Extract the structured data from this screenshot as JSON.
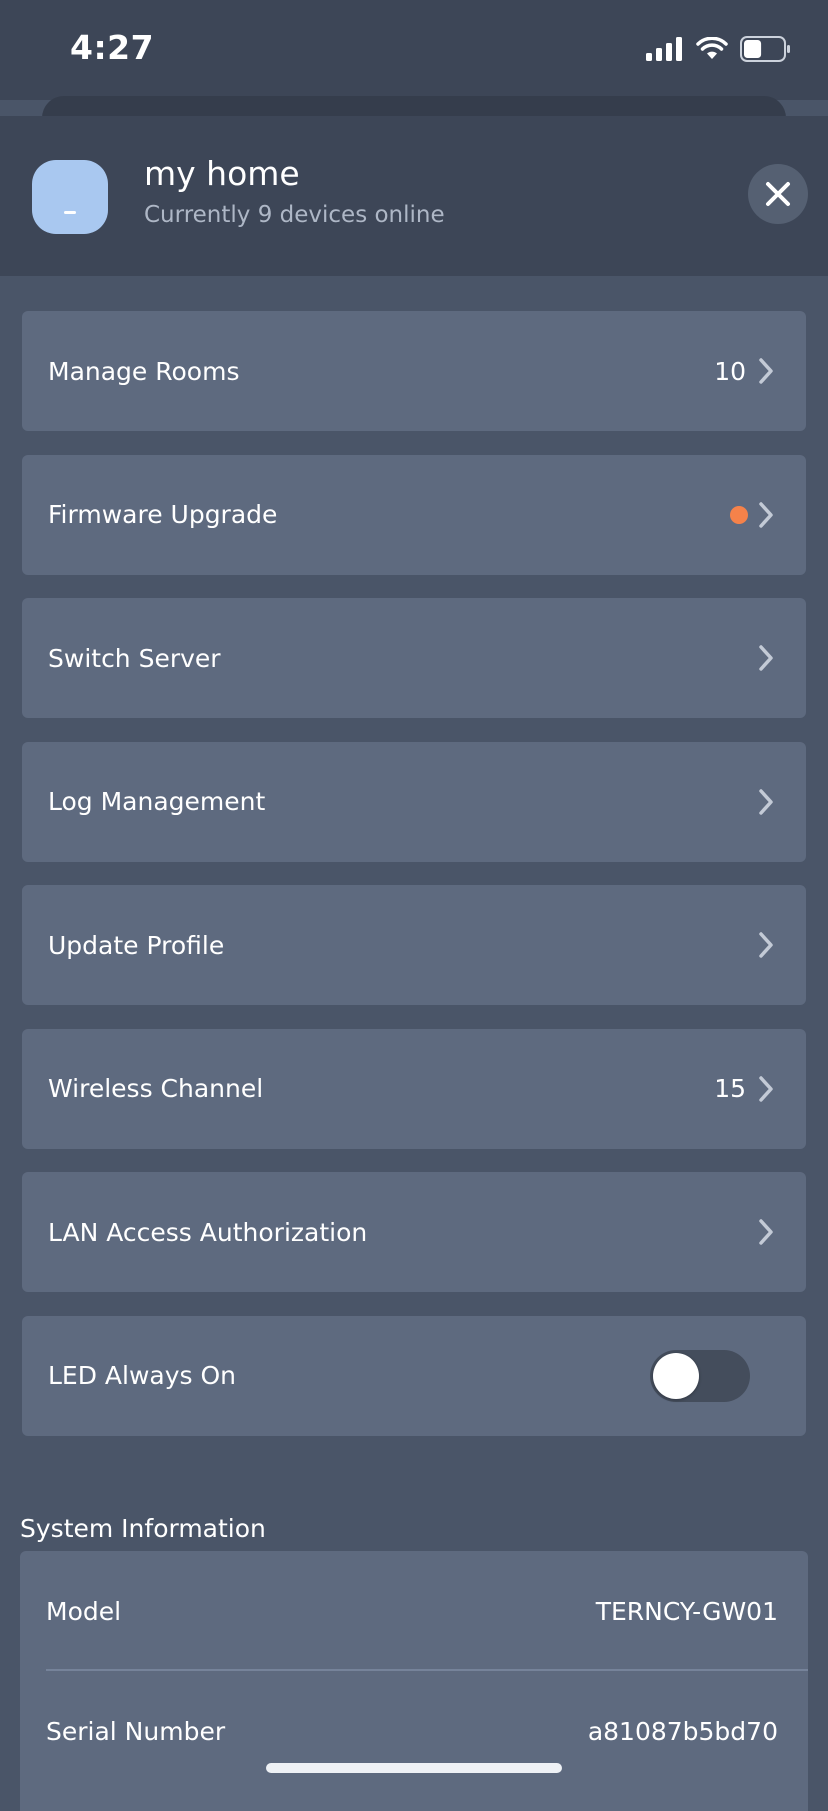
{
  "status_bar": {
    "time": "4:27",
    "battery_level": 0.45
  },
  "header": {
    "title": "my home",
    "subtitle": "Currently 9 devices online"
  },
  "menu": [
    {
      "label": "Manage Rooms",
      "value": "10"
    },
    {
      "label": "Firmware Upgrade",
      "value": ""
    },
    {
      "label": "Switch Server",
      "value": ""
    },
    {
      "label": "Log Management",
      "value": ""
    },
    {
      "label": "Update Profile",
      "value": ""
    },
    {
      "label": "Wireless Channel",
      "value": "15"
    },
    {
      "label": "LAN Access Authorization",
      "value": ""
    },
    {
      "label": "LED Always On",
      "toggle_on": false
    }
  ],
  "system_info": {
    "title": "System Information",
    "rows": [
      {
        "label": "Model",
        "value": "TERNCY-GW01"
      },
      {
        "label": "Serial Number",
        "value": "a81087b5bd70"
      }
    ]
  },
  "colors": {
    "background": "#4a5568",
    "header": "#3d4657",
    "card": "#5e6a7f",
    "badge": "#f5824a",
    "avatar": "#a9c8f0"
  }
}
